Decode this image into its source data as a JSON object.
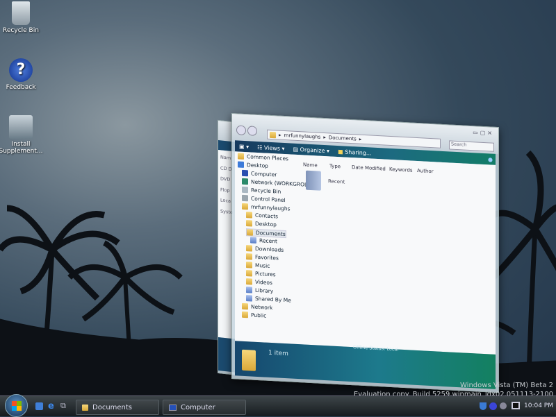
{
  "desktop": {
    "icons": [
      {
        "label": "Recycle Bin"
      },
      {
        "label": "Feedback"
      },
      {
        "label": "Install Supplement..."
      }
    ]
  },
  "watermark": {
    "line1": "Windows Vista (TM) Beta 2",
    "line2": "Evaluation copy. Build 5259.winmain_idx02.051113-2100"
  },
  "back_window": {
    "items": [
      "Nam",
      "CD D",
      "DVD",
      "Flop",
      "Loca",
      "Syste"
    ]
  },
  "explorer": {
    "breadcrumb": [
      "mrfunnylaughs",
      "Documents"
    ],
    "search_placeholder": "Search",
    "toolbar": {
      "views": "Views",
      "organize": "Organize",
      "sharing": "Sharing..."
    },
    "nav": [
      {
        "label": "Common Places",
        "level": 0,
        "icon": "folder"
      },
      {
        "label": "Desktop",
        "level": 0,
        "icon": "desktop"
      },
      {
        "label": "Computer",
        "level": 1,
        "icon": "computer"
      },
      {
        "label": "Network (WORKGROL",
        "level": 1,
        "icon": "network"
      },
      {
        "label": "Recycle Bin",
        "level": 1,
        "icon": "recycle"
      },
      {
        "label": "Control Panel",
        "level": 1,
        "icon": "control"
      },
      {
        "label": "mrfunnylaughs",
        "level": 1,
        "icon": "folder"
      },
      {
        "label": "Contacts",
        "level": 2,
        "icon": "folder"
      },
      {
        "label": "Desktop",
        "level": 2,
        "icon": "folder"
      },
      {
        "label": "Documents",
        "level": 2,
        "icon": "folder",
        "selected": true
      },
      {
        "label": "Recent",
        "level": 3,
        "icon": "library"
      },
      {
        "label": "Downloads",
        "level": 2,
        "icon": "folder"
      },
      {
        "label": "Favorites",
        "level": 2,
        "icon": "folder"
      },
      {
        "label": "Music",
        "level": 2,
        "icon": "folder"
      },
      {
        "label": "Pictures",
        "level": 2,
        "icon": "folder"
      },
      {
        "label": "Videos",
        "level": 2,
        "icon": "folder"
      },
      {
        "label": "Library",
        "level": 2,
        "icon": "library"
      },
      {
        "label": "Shared By Me",
        "level": 2,
        "icon": "library"
      },
      {
        "label": "Network",
        "level": 1,
        "icon": "folder"
      },
      {
        "label": "Public",
        "level": 1,
        "icon": "folder"
      }
    ],
    "columns": [
      "Name",
      "Type",
      "Date Modified",
      "Keywords",
      "Author"
    ],
    "files": [
      {
        "name": "Recent"
      }
    ],
    "status": {
      "count": "1 item",
      "offline": "Offline Status: Local"
    }
  },
  "taskbar": {
    "buttons": [
      {
        "label": "Documents"
      },
      {
        "label": "Computer"
      }
    ],
    "clock": "10:04 PM"
  }
}
